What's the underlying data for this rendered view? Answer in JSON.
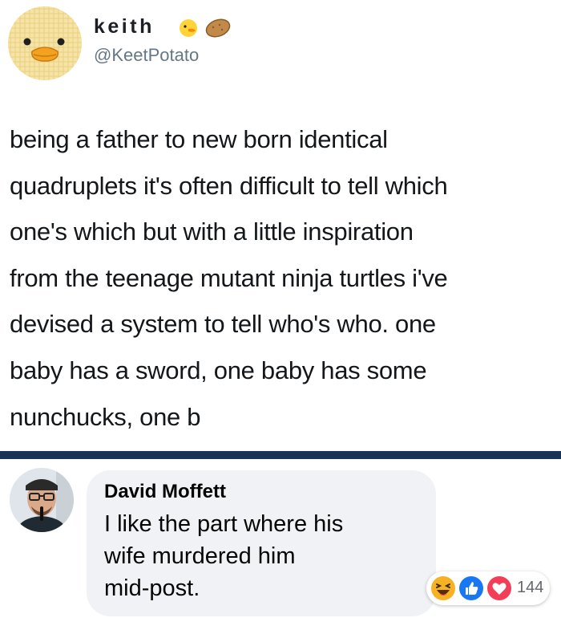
{
  "tweet": {
    "display_name": "keith",
    "handle": "@KeetPotato",
    "name_emojis": [
      "duck-emoji-icon",
      "potato-emoji-icon"
    ],
    "body_lines": [
      "being a father to new born identical",
      "quadruplets it's often difficult to tell which",
      "one's which but with a little inspiration",
      "from the teenage mutant ninja turtles i've",
      "devised a system to tell who's who. one",
      "baby has a sword, one baby has some",
      "nunchucks, one b"
    ]
  },
  "comment": {
    "author": "David Moffett",
    "text_lines": [
      "I like the part where his",
      "wife murdered him",
      "mid-post."
    ],
    "reactions": {
      "icons": [
        "haha-reaction-icon",
        "like-reaction-icon",
        "love-reaction-icon"
      ],
      "count": "144"
    }
  },
  "colors": {
    "divider": "#173357",
    "bubble": "#f0f2f5",
    "like": "#1877f2",
    "love": "#f33e58",
    "haha": "#f7b125"
  }
}
